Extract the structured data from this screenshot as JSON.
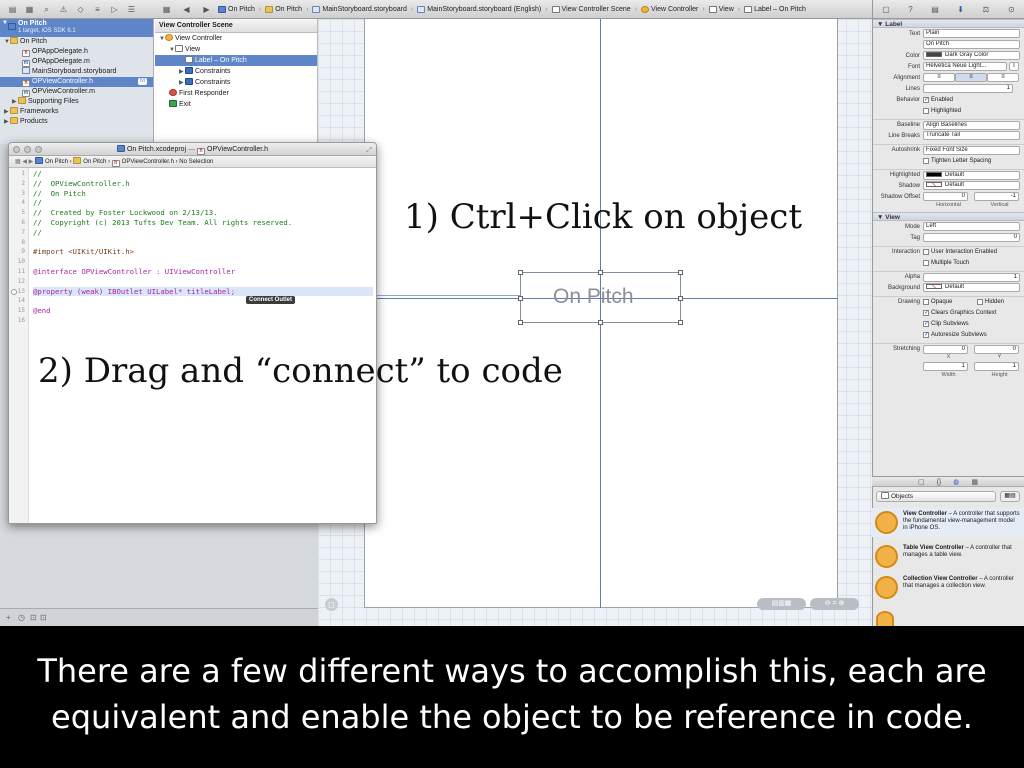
{
  "toolbar": {
    "breadcrumbs": [
      "On Pitch",
      "On Pitch",
      "MainStoryboard.storyboard",
      "MainStoryboard.storyboard (English)",
      "View Controller Scene",
      "View Controller",
      "View",
      "Label – On Pitch"
    ]
  },
  "navigator": {
    "project_name": "On Pitch",
    "project_sub": "1 target, iOS SDK 6.1",
    "items": [
      {
        "label": "On Pitch",
        "icon": "folder-icon"
      },
      {
        "label": "OPAppDelegate.h",
        "icon": "header-file-icon"
      },
      {
        "label": "OPAppDelegate.m",
        "icon": "implementation-file-icon"
      },
      {
        "label": "MainStoryboard.storyboard",
        "icon": "storyboard-icon"
      },
      {
        "label": "OPViewController.h",
        "icon": "header-file-icon",
        "badge": "M"
      },
      {
        "label": "OPViewController.m",
        "icon": "implementation-file-icon"
      },
      {
        "label": "Supporting Files",
        "icon": "folder-icon"
      },
      {
        "label": "Frameworks",
        "icon": "folder-icon"
      },
      {
        "label": "Products",
        "icon": "folder-icon"
      }
    ]
  },
  "outline": {
    "title": "View Controller Scene",
    "items": [
      "View Controller",
      "View",
      "Label – On Pitch",
      "Constraints",
      "Constraints",
      "First Responder",
      "Exit"
    ]
  },
  "canvas": {
    "label_text": "On Pitch"
  },
  "editor": {
    "window_title_left": "On Pitch.xcodeproj",
    "window_title_right": "OPViewController.h",
    "jump_bar": [
      "On Pitch",
      "On Pitch",
      "OPViewController.h",
      "No Selection"
    ],
    "line_numbers": [
      "1",
      "2",
      "3",
      "4",
      "5",
      "6",
      "7",
      "8",
      "9",
      "10",
      "11",
      "12",
      "13",
      "14",
      "15",
      "16"
    ],
    "lines": [
      "//",
      "//  OPViewController.h",
      "//  On Pitch",
      "//",
      "//  Created by Foster Lockwood on 2/13/13.",
      "//  Copyright (c) 2013 Tufts Dev Team. All rights reserved.",
      "//",
      "",
      "#import <UIKit/UIKit.h>",
      "",
      "@interface OPViewController : UIViewController",
      "",
      "@property (weak) IBOutlet UILabel* titleLabel;",
      "",
      "@end",
      ""
    ],
    "tooltip": "Connect Outlet"
  },
  "inspector": {
    "label_section": "Label",
    "text_type": "Plain",
    "text_value": "On Pitch",
    "color": "Dark Gray Color",
    "font": "Helvetica Neue Light...",
    "alignment_label": "Alignment",
    "lines": "1",
    "behavior_enabled": "Enabled",
    "behavior_highlighted": "Highlighted",
    "baseline": "Align Baselines",
    "line_breaks": "Truncate Tail",
    "autoshrink": "Fixed Font Size",
    "tighten": "Tighten Letter Spacing",
    "highlighted": "Default",
    "shadow": "Default",
    "shadow_offset_x": "0",
    "shadow_offset_y": "-1",
    "horizontal": "Horizontal",
    "vertical": "Vertical",
    "view_section": "View",
    "mode": "Left",
    "tag": "0",
    "interaction_1": "User Interaction Enabled",
    "interaction_2": "Multiple Touch",
    "alpha": "1",
    "background": "Default",
    "drawing_opaque": "Opaque",
    "drawing_hidden": "Hidden",
    "drawing_clears": "Clears Graphics Context",
    "drawing_clip": "Clip Subviews",
    "drawing_autoresize": "Autoresize Subviews",
    "stretch_x": "0",
    "stretch_y": "0",
    "stretch_w": "1",
    "stretch_h": "1",
    "labels": {
      "text": "Text",
      "color": "Color",
      "font": "Font",
      "lines": "Lines",
      "behavior": "Behavior",
      "baseline": "Baseline",
      "line_breaks": "Line Breaks",
      "autoshrink": "Autoshrink",
      "highlighted": "Highlighted",
      "shadow": "Shadow",
      "shadow_offset": "Shadow Offset",
      "mode": "Mode",
      "tag": "Tag",
      "interaction": "Interaction",
      "alpha": "Alpha",
      "background": "Background",
      "drawing": "Drawing",
      "stretching": "Stretching",
      "x": "X",
      "y": "Y",
      "width": "Width",
      "height": "Height"
    }
  },
  "library": {
    "filter": "Objects",
    "items": [
      {
        "name": "View Controller",
        "desc": " – A controller that supports the fundamental view-management model in iPhone OS."
      },
      {
        "name": "Table View Controller",
        "desc": " – A controller that manages a table view."
      },
      {
        "name": "Collection View Controller",
        "desc": " – A controller that manages a collection view."
      }
    ]
  },
  "overlay": {
    "step1": "1) Ctrl+Click on object",
    "step2": "2) Drag and “connect” to code"
  },
  "caption": {
    "line1": "There are a few different ways to accomplish this, each are",
    "line2": "equivalent and enable the object to be reference in code."
  }
}
